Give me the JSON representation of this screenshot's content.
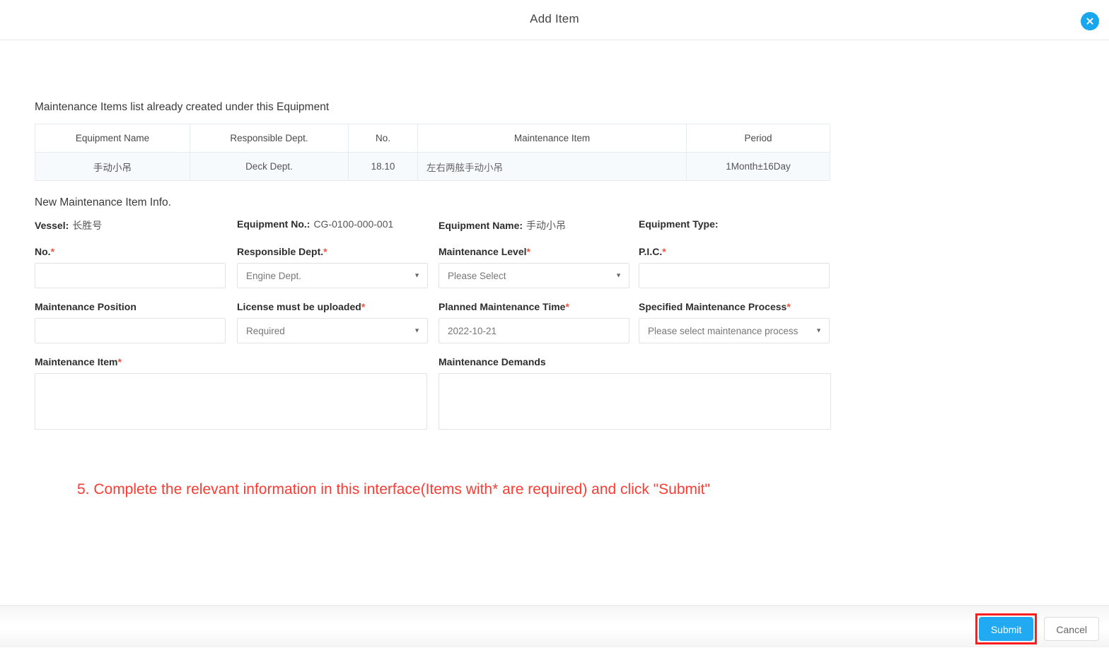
{
  "dialog": {
    "title": "Add Item",
    "close_icon": "close-circle-icon"
  },
  "existing": {
    "section_title": "Maintenance Items list already created under this Equipment",
    "columns": [
      "Equipment Name",
      "Responsible Dept.",
      "No.",
      "Maintenance Item",
      "Period"
    ],
    "rows": [
      {
        "equipment_name": "手动小吊",
        "responsible_dept": "Deck Dept.",
        "no": "18.10",
        "maintenance_item": "左右两舷手动小吊",
        "period": "1Month±16Day"
      }
    ]
  },
  "new_item": {
    "section_title": "New Maintenance Item Info.",
    "info": {
      "vessel_label": "Vessel:",
      "vessel_value": "长胜号",
      "equipment_no_label": "Equipment No.:",
      "equipment_no_value": "CG-0100-000-001",
      "equipment_name_label": "Equipment Name:",
      "equipment_name_value": "手动小吊",
      "equipment_type_label": "Equipment Type:",
      "equipment_type_value": ""
    },
    "fields": {
      "no": {
        "label": "No.",
        "required": true,
        "value": ""
      },
      "responsible_dept": {
        "label": "Responsible Dept.",
        "required": true,
        "value": "Engine Dept.",
        "caret": "▼"
      },
      "maintenance_level": {
        "label": "Maintenance Level",
        "required": true,
        "value": "Please Select",
        "caret": "▼"
      },
      "pic": {
        "label": "P.I.C.",
        "required": true,
        "value": ""
      },
      "maintenance_position": {
        "label": "Maintenance Position",
        "required": false,
        "value": ""
      },
      "license_must_be_uploaded": {
        "label": "License must be uploaded",
        "required": true,
        "value": "Required",
        "caret": "▼"
      },
      "planned_maintenance_time": {
        "label": "Planned Maintenance Time",
        "required": true,
        "value": "2022-10-21"
      },
      "specified_maintenance_process": {
        "label": "Specified Maintenance Process",
        "required": true,
        "value": "Please select maintenance process",
        "caret": "▼"
      },
      "maintenance_item": {
        "label": "Maintenance Item",
        "required": true,
        "value": ""
      },
      "maintenance_demands": {
        "label": "Maintenance Demands",
        "required": false,
        "value": ""
      }
    }
  },
  "annotation": {
    "text": "5. Complete the relevant information in this interface(Items with* are required) and click \"Submit\"",
    "color": "#fd3b33"
  },
  "footer": {
    "submit_label": "Submit",
    "cancel_label": "Cancel",
    "submit_color": "#21aaf2",
    "highlight_color": "#fe1d1d"
  }
}
